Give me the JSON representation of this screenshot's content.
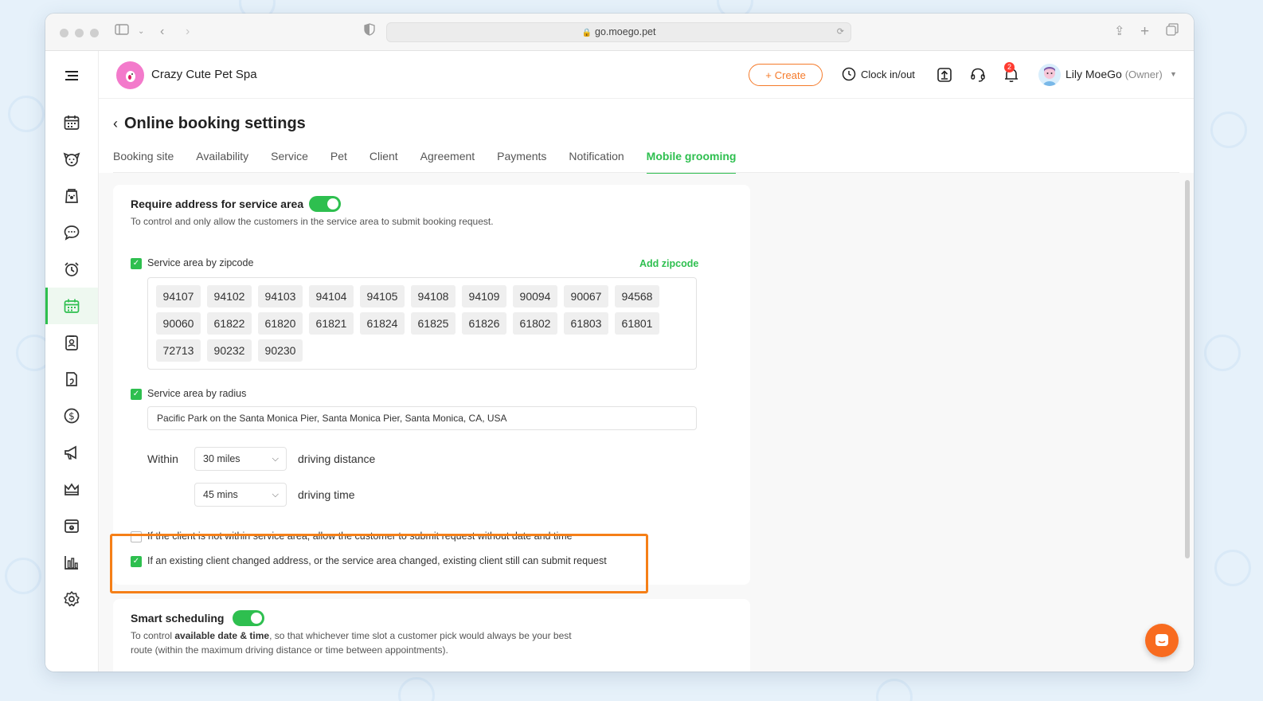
{
  "browser": {
    "url": "go.moego.pet"
  },
  "topbar": {
    "business_name": "Crazy Cute Pet Spa",
    "create_label": "Create",
    "clock_label": "Clock in/out",
    "notification_count": "2",
    "user_name": "Lily MoeGo",
    "user_role": "(Owner)"
  },
  "sidebar": {
    "items": [
      {
        "name": "calendar"
      },
      {
        "name": "pets"
      },
      {
        "name": "retail"
      },
      {
        "name": "messages"
      },
      {
        "name": "reminders"
      },
      {
        "name": "online-booking",
        "active": true
      },
      {
        "name": "clients"
      },
      {
        "name": "reports-docs"
      },
      {
        "name": "payments"
      },
      {
        "name": "marketing"
      },
      {
        "name": "memberships"
      },
      {
        "name": "schedule"
      },
      {
        "name": "insights"
      },
      {
        "name": "settings"
      }
    ]
  },
  "page": {
    "title": "Online booking settings",
    "tabs": [
      "Booking site",
      "Availability",
      "Service",
      "Pet",
      "Client",
      "Agreement",
      "Payments",
      "Notification",
      "Mobile grooming"
    ],
    "active_tab": "Mobile grooming"
  },
  "service_area": {
    "title": "Require address for service area",
    "enabled": true,
    "description": "To control and only allow the customers in the service area to submit booking request.",
    "zipcode_label": "Service area by zipcode",
    "zipcode_checked": true,
    "add_zipcode": "Add zipcode",
    "zipcodes": [
      "94107",
      "94102",
      "94103",
      "94104",
      "94105",
      "94108",
      "94109",
      "90094",
      "90067",
      "94568",
      "90060",
      "61822",
      "61820",
      "61821",
      "61824",
      "61825",
      "61826",
      "61802",
      "61803",
      "61801",
      "72713",
      "90232",
      "90230"
    ],
    "radius_label": "Service area by radius",
    "radius_checked": true,
    "address": "Pacific Park on the Santa Monica Pier, Santa Monica Pier, Santa Monica, CA, USA",
    "within_label": "Within",
    "distance_value": "30 miles",
    "distance_label": "driving distance",
    "time_value": "45 mins",
    "time_label": "driving time",
    "option1": "If the client is not within service area, allow the customer to submit request without date and time",
    "option1_checked": false,
    "option2": "If an existing client changed address, or the service area changed, existing client still can submit request",
    "option2_checked": true
  },
  "smart_scheduling": {
    "title": "Smart scheduling",
    "enabled": true,
    "desc_prefix": "To control ",
    "desc_bold": "available date & time",
    "desc_suffix": ", so that whichever time slot a customer pick would always be your best",
    "desc_line2": "route (within the maximum driving distance or time between appointments)."
  },
  "colors": {
    "accent": "#2ebf4f",
    "brand_orange": "#f57a2a",
    "highlight": "#f57f17"
  }
}
